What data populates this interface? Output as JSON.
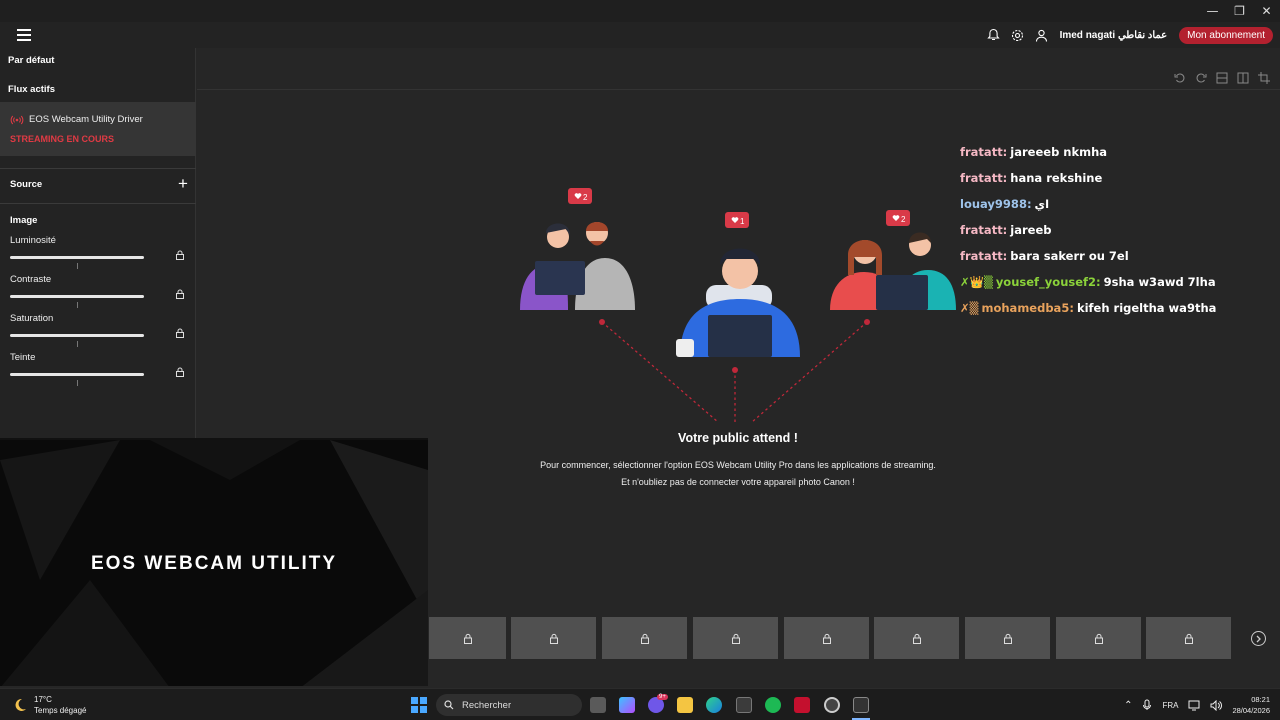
{
  "window": {
    "minimize": "—",
    "restore": "❐",
    "close": "✕"
  },
  "topbar": {
    "user_name": "Imed nagati عماد نقاطي",
    "subscription_label": "Mon abonnement"
  },
  "sidebar": {
    "default_label": "Par défaut",
    "active_streams_label": "Flux actifs",
    "stream_name": "EOS Webcam Utility Driver",
    "stream_status": "STREAMING EN COURS",
    "source_label": "Source",
    "image_label": "Image",
    "sliders": [
      {
        "label": "Luminosité",
        "value": 0.5
      },
      {
        "label": "Contraste",
        "value": 0.5
      },
      {
        "label": "Saturation",
        "value": 0.5
      },
      {
        "label": "Teinte",
        "value": 0.5
      }
    ]
  },
  "preview": {
    "title": "EOS WEBCAM UTILITY"
  },
  "main": {
    "title": "Votre public attend !",
    "line1": "Pour commencer, sélectionner l'option EOS Webcam Utility Pro dans les applications de streaming.",
    "line2": "Et n'oubliez pas de connecter votre appareil photo Canon !",
    "badges": [
      "2",
      "1",
      "2"
    ]
  },
  "chat": [
    {
      "name": "fratatt:",
      "msg": "jareeeb nkmha",
      "color": "#f5b8c4",
      "prefix": ""
    },
    {
      "name": "fratatt:",
      "msg": "hana rekshine",
      "color": "#f5b8c4",
      "prefix": ""
    },
    {
      "name": "louay9988:",
      "msg": "اي",
      "color": "#9ec3ea",
      "prefix": ""
    },
    {
      "name": "fratatt:",
      "msg": "jareeb",
      "color": "#f5b8c4",
      "prefix": ""
    },
    {
      "name": "fratatt:",
      "msg": "bara sakerr ou 7el",
      "color": "#f5b8c4",
      "prefix": ""
    },
    {
      "name": "yousef_yousef2:",
      "msg": "9sha w3awd 7lha",
      "color": "#8bd23a",
      "prefix": "✗👑▒"
    },
    {
      "name": "mohamedba5:",
      "msg": "kifeh rigeltha wa9tha",
      "color": "#e8a25c",
      "prefix": "✗▒"
    }
  ],
  "taskbar": {
    "temperature": "17°C",
    "weather": "Temps dégagé",
    "search_placeholder": "Rechercher",
    "language": "FRA",
    "time": "08:21",
    "date": "28/04/2026",
    "badge": "9+"
  },
  "colors": {
    "accent": "#b3212f",
    "status_red": "#e03a44"
  }
}
